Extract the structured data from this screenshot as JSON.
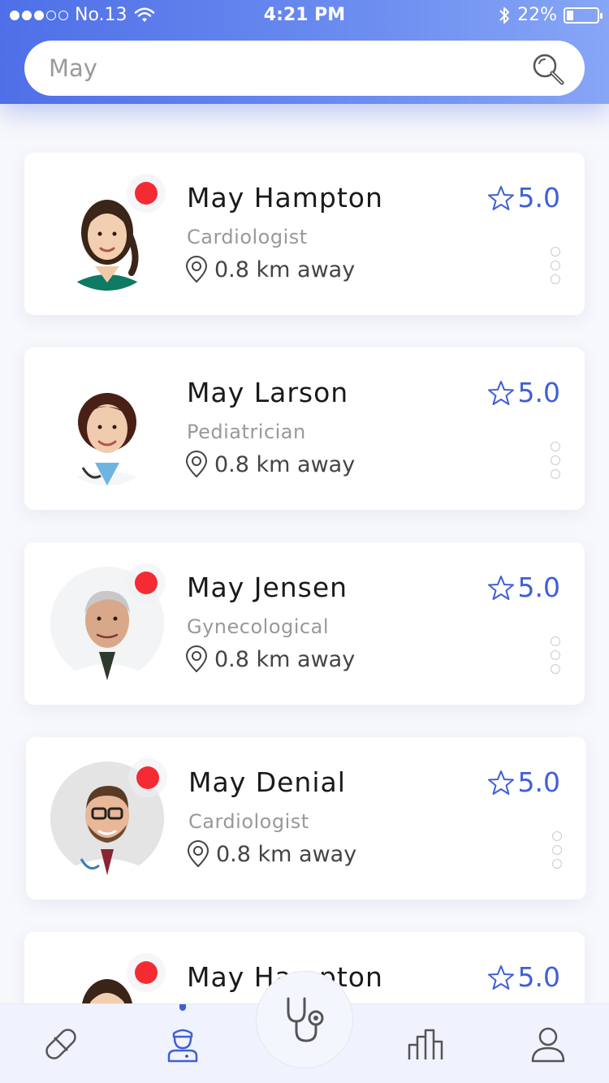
{
  "status_bar": {
    "carrier": "No.13",
    "time": "4:21 PM",
    "battery_text": "22%",
    "battery_level": 0.22
  },
  "search": {
    "value": "May",
    "icon": "search-icon"
  },
  "doctors": [
    {
      "name": "May Hampton",
      "specialty": "Cardiologist",
      "distance": "0.8 km away",
      "rating": "5.0",
      "online": true
    },
    {
      "name": "May Larson",
      "specialty": "Pediatrician",
      "distance": "0.8 km away",
      "rating": "5.0",
      "online": false
    },
    {
      "name": "May Jensen",
      "specialty": "Gynecological",
      "distance": "0.8 km away",
      "rating": "5.0",
      "online": true
    },
    {
      "name": "May Denial",
      "specialty": "Cardiologist",
      "distance": "0.8 km away",
      "rating": "5.0",
      "online": true
    },
    {
      "name": "May Hampton",
      "specialty": "",
      "distance": "",
      "rating": "5.0",
      "online": true
    }
  ],
  "tabbar": {
    "items": [
      "pill-icon",
      "doctor-icon",
      "stethoscope-icon",
      "chart-icon",
      "profile-icon"
    ],
    "active": "doctor-icon"
  },
  "colors": {
    "accent": "#3f5fd6",
    "header_gradient_start": "#4f6fe8",
    "header_gradient_end": "#87a6f6",
    "online_dot": "#f52b34"
  }
}
